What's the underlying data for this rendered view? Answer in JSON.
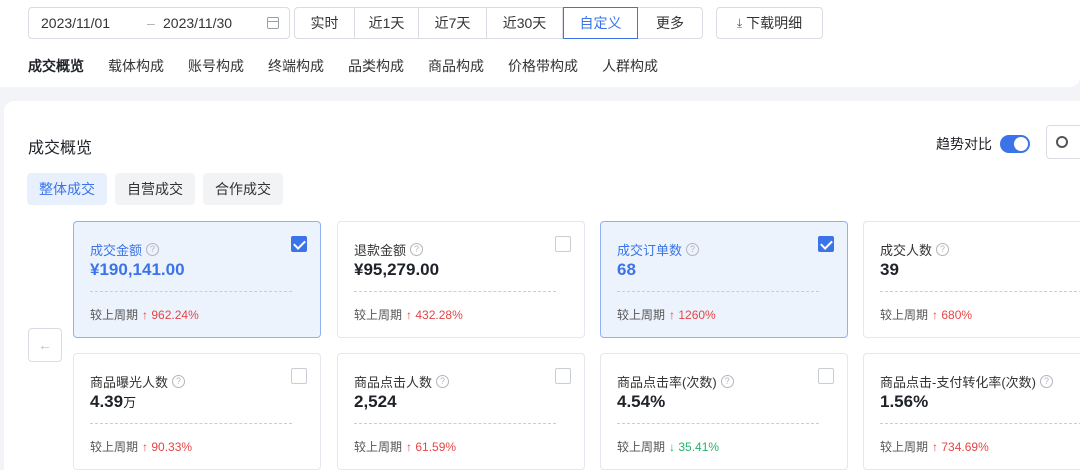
{
  "date_range": {
    "start": "2023/11/01",
    "separator": "–",
    "end": "2023/11/30"
  },
  "time_options": [
    "实时",
    "近1天",
    "近7天",
    "近30天",
    "自定义",
    "更多"
  ],
  "time_active": "自定义",
  "download": {
    "icon": "download-icon",
    "label": "下载明细"
  },
  "nav_tabs": [
    "成交概览",
    "载体构成",
    "账号构成",
    "终端构成",
    "品类构成",
    "商品构成",
    "价格带构成",
    "人群构成"
  ],
  "nav_active": "成交概览",
  "section": {
    "title": "成交概览",
    "trend_label": "趋势对比",
    "trend_on": true
  },
  "sub_tabs": [
    "整体成交",
    "自营成交",
    "合作成交"
  ],
  "sub_active": "整体成交",
  "colors": {
    "accent": "#3a74e8",
    "up": "#e54545",
    "down": "#24b36b"
  },
  "metrics": [
    {
      "label": "成交金额",
      "value": "¥190,141.00",
      "unit": "",
      "compare_label": "较上周期",
      "change": "962.24%",
      "direction": "up",
      "selected": true
    },
    {
      "label": "退款金额",
      "value": "¥95,279.00",
      "unit": "",
      "compare_label": "较上周期",
      "change": "432.28%",
      "direction": "up",
      "selected": false
    },
    {
      "label": "成交订单数",
      "value": "68",
      "unit": "",
      "compare_label": "较上周期",
      "change": "1260%",
      "direction": "up",
      "selected": true
    },
    {
      "label": "成交人数",
      "value": "39",
      "unit": "",
      "compare_label": "较上周期",
      "change": "680%",
      "direction": "up",
      "selected": false
    },
    {
      "label": "商品曝光人数",
      "value": "4.39",
      "unit": "万",
      "compare_label": "较上周期",
      "change": "90.33%",
      "direction": "up",
      "selected": false
    },
    {
      "label": "商品点击人数",
      "value": "2,524",
      "unit": "",
      "compare_label": "较上周期",
      "change": "61.59%",
      "direction": "up",
      "selected": false
    },
    {
      "label": "商品点击率(次数)",
      "value": "4.54%",
      "unit": "",
      "compare_label": "较上周期",
      "change": "35.41%",
      "direction": "down",
      "selected": false
    },
    {
      "label": "商品点击-支付转化率(次数)",
      "value": "1.56%",
      "unit": "",
      "compare_label": "较上周期",
      "change": "734.69%",
      "direction": "up",
      "selected": false
    }
  ]
}
